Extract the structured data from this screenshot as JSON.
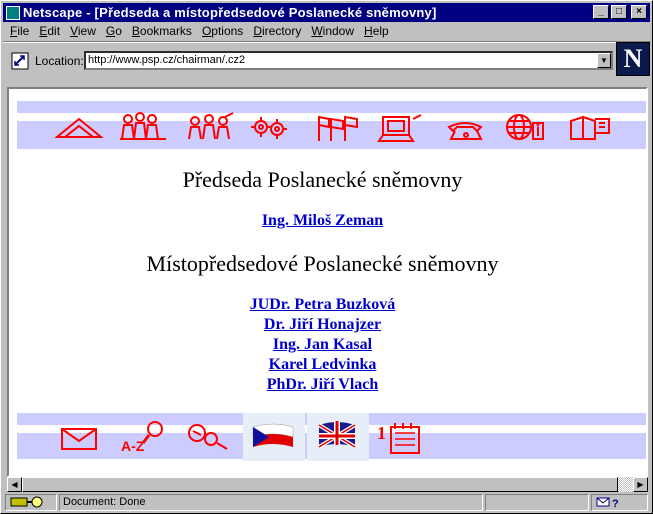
{
  "window": {
    "title": "Netscape - [Předseda a místopředsedové Poslanecké sněmovny]"
  },
  "menu": [
    {
      "label": "File",
      "key": "F",
      "rest": "ile"
    },
    {
      "label": "Edit",
      "key": "E",
      "rest": "dit"
    },
    {
      "label": "View",
      "key": "V",
      "rest": "iew"
    },
    {
      "label": "Go",
      "key": "G",
      "rest": "o"
    },
    {
      "label": "Bookmarks",
      "key": "B",
      "rest": "ookmarks"
    },
    {
      "label": "Options",
      "key": "O",
      "rest": "ptions"
    },
    {
      "label": "Directory",
      "key": "D",
      "rest": "irectory"
    },
    {
      "label": "Window",
      "key": "W",
      "rest": "indow"
    },
    {
      "label": "Help",
      "key": "H",
      "rest": "elp"
    }
  ],
  "location": {
    "label": "Location:",
    "url": "http://www.psp.cz/chairman/.cz2"
  },
  "logo": {
    "letter": "N"
  },
  "page": {
    "heading1": "Předseda Poslanecké sněmovny",
    "chairman": "Ing. Miloš Zeman",
    "heading2": "Místopředsedové Poslanecké sněmovny",
    "vice_chairs": [
      "JUDr. Petra Buzková",
      "Dr. Jiří Honajzer",
      "Ing. Jan Kasal",
      "Karel Ledvinka",
      "PhDr. Jiří Vlach"
    ]
  },
  "nav_icons_top": [
    "home-icon",
    "assembly-icon",
    "committees-icon",
    "gears-icon",
    "flags-icon",
    "computer-icon",
    "phone-icon",
    "globe-info-icon",
    "books-icon"
  ],
  "nav_icons_bottom": [
    "mail-icon",
    "a-z-search-icon",
    "search-icon",
    "czech-flag-icon",
    "uk-flag-icon",
    "calendar-icon"
  ],
  "status": {
    "text": "Document: Done"
  },
  "colors": {
    "band": "#ccccff",
    "icon": "#ff0000",
    "link": "#0000cc",
    "titlebar": "#000080"
  }
}
